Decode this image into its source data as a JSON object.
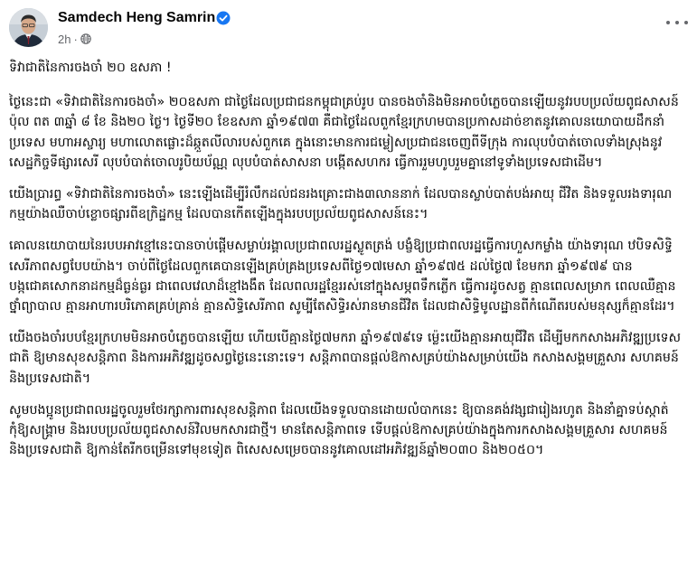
{
  "post": {
    "author_name": "Samdech Heng Samrin",
    "timestamp": "2h",
    "separator": "·",
    "icons": {
      "verified": "verified-badge-icon",
      "audience": "globe-icon",
      "more": "more-options-icon"
    },
    "colors": {
      "verified_blue": "#1877f2",
      "meta_gray": "#65676b",
      "text": "#050505"
    },
    "paragraphs": [
      "ទិវាជាតិនៃការចងចាំ ២០ ឧសភា !",
      "ថ្ងៃនេះជា «ទិវាជាតិនៃការចងចាំ» ២០ឧសភា ជាថ្ងៃដែលប្រជាជនកម្ពុជាគ្រប់រូប បានចងចាំនិងមិនអាចបំភ្លេចបានឡើយនូវរបបប្រល័យពូជសាសន៍ ប៉ុល ពត ៣ឆ្នាំ ៨ ខែ និង២០ ថ្ងៃ។ ថ្ងៃទី២០ ខែឧសភា ឆ្នាំ១៩៧៣ គឺជាថ្ងៃដែលពួកខ្មែរក្រហមបានប្រកាសដាច់ខាតនូវគោលនយោបាយដឹកនាំប្រទេស មហាអស្ចារ្យ មហាលោតផ្លោះដ៏ឆ្កួតលីលារបស់ពួកគេ ក្នុងនោះមានការជម្លៀសប្រជាជនចេញពីទីក្រុង ការលុបបំបាត់ចោលទាំងស្រុងនូវសេដ្ឋកិច្ចទីផ្សារសេរី លុបបំបាត់ចោលរូបិយប័ណ្ណ លុបបំបាត់សាសនា បង្កើតសហករ ធ្វើការរួមហូបរួមគ្នានៅទូទាំងប្រទេសជាដើម។",
      "យើងប្រារព្ធ «ទិវាជាតិនៃការចងចាំ» នេះឡើងដើម្បីរំលឹកដល់ជនរងគ្រោះជាង៣លាននាក់ ដែលបានស្លាប់បាត់បង់អាយុ ជីវិត និងទទួលរងទារុណកម្មយ៉ាងឈឺចាប់ខ្លោចផ្សារពីឧក្រិដ្ឋកម្ម ដែលបានកើតឡើងក្នុងរបបប្រល័យពូជសាសន៍នេះ។",
      "គោលនយោបាយនៃរបបអាវខ្មៅនេះបានចាប់ផ្តើមសម្លាប់រង្គាលប្រជាពលរដ្ឋស្លូតត្រង់ បង្ខំឱ្យប្រជាពលរដ្ឋធ្វើការហួសកម្លាំង យ៉ាងទារុណ ឋបិទសិទ្ធិសេរីភាពសព្វបែបយ៉ាង។ ចាប់ពីថ្ងៃដែលពួកគេបានឡើងគ្រប់គ្រងប្រទេសពីថ្ងៃ១៧មេសា ឆ្នាំ១៩៧៥ ដល់ថ្ងៃ៧ ខែមករា ឆ្នាំ១៩៧៩ បាន បង្កជោគសោកនាដកម្មដ៏ធ្ងន់ធ្ងរ ជាពេលវេលាដ៏ខ្មៅងងឹត ដែលពលរដ្ឋខ្មែររស់នៅក្នុងសម្ភពទឹកភ្លើក ធ្វើការដូចសត្វ គ្មានពេលសម្រាក ពេលឈឺគ្មានថ្នាំព្យាបាល គ្មានអាហារបរិភោគគ្រប់គ្រាន់ គ្មានសិទ្ធិសេរីភាព សូម្បីតែសិទ្ធិរស់រានមានជីវិត ដែលជាសិទ្ធិមូលដ្ឋានពីកំណើតរបស់មនុស្សក៏គ្មានដែរ។",
      "យើងចងចាំរបបខ្មែរក្រហមមិនអាចបំភ្លេចបានឡើយ ហើយបើគ្មានថ្ងៃ៧មករា ឆ្នាំ១៩៧៩ទេ ម្ល៉េះយើងគ្មានអាយុជីវិត ដើម្បីមកកសាងអភិវឌ្ឍប្រទេសជាតិ ឱ្យមានសុខសន្តិភាព និងការអភិវឌ្ឍដូចសព្វថ្ងៃនេះនោះទេ។ សន្តិភាពបានផ្តល់ឱកាសគ្រប់យ៉ាងសម្រាប់យើង កសាងសង្គមគ្រួសារ សហគមន៍ និងប្រទេសជាតិ។",
      "សូមបងប្អូនប្រជាពលរដ្ឋចូលរួមថែរក្សាការពារសុខសន្តិភាព ដែលយើងទទួលបានដោយលំបាកនេះ ឱ្យបានគង់វង្សជារៀងរហូត និងនាំគ្នាទប់ស្កាត់កុំឱ្យសង្គ្រាម និងរបបប្រល័យពូជសាសន៍វិលមកសារជាថ្មី។ មានតែសន្តិភាពទេ ទើបផ្តល់ឱកាសគ្រប់យ៉ាងក្នុងការកសាងសង្គមគ្រួសារ សហគមន៍ និងប្រទេសជាតិ ឱ្យកាន់តែរីកចម្រើនទៅមុខទៀត ពិសេសសម្រេចបាននូវគោលដៅអភិវឌ្ឍន៍ឆ្នាំ២០៣០ និង២០៥០។"
    ]
  }
}
